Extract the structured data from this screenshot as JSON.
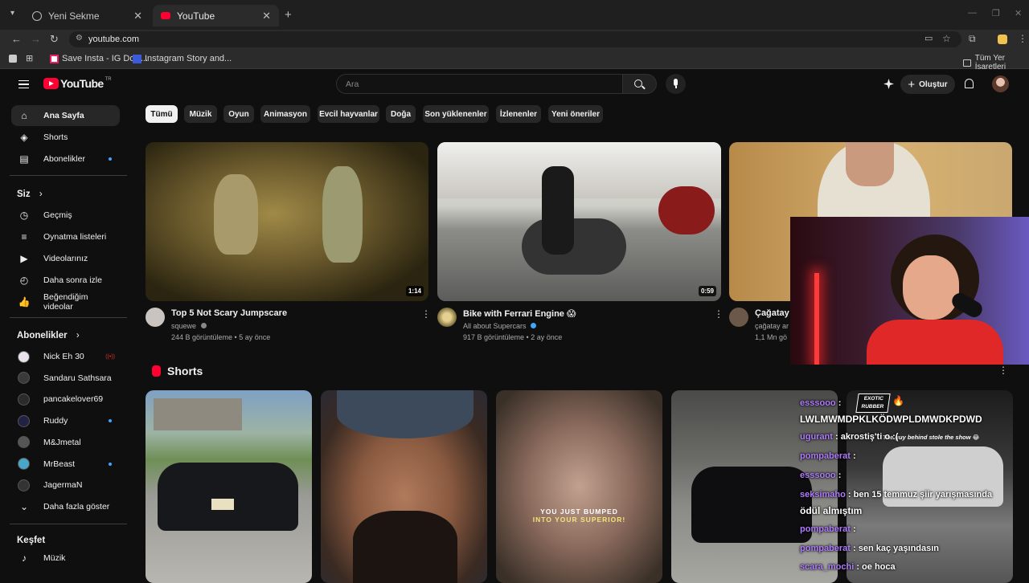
{
  "browser": {
    "tabs": [
      {
        "label": "Yeni Sekme",
        "active": false
      },
      {
        "label": "YouTube",
        "active": true
      }
    ],
    "new_tab_icon": "+",
    "url": "youtube.com",
    "bookmarks": [
      {
        "label": "Save Insta - IG Dow..."
      },
      {
        "label": "Instagram Story and..."
      }
    ],
    "all_bookmarks_label": "Tüm Yer İşaretleri"
  },
  "header": {
    "logo_text": "YouTube",
    "logo_region": "TR",
    "search_placeholder": "Ara",
    "create_label": "Oluştur"
  },
  "sidebar": {
    "main_items": [
      {
        "label": "Ana Sayfa",
        "icon": "home-icon",
        "active": true
      },
      {
        "label": "Shorts",
        "icon": "shorts-icon"
      },
      {
        "label": "Abonelikler",
        "icon": "subscriptions-icon",
        "dot": true
      }
    ],
    "you_heading": "Siz",
    "you_items": [
      {
        "label": "Geçmiş",
        "icon": "history-icon"
      },
      {
        "label": "Oynatma listeleri",
        "icon": "playlists-icon"
      },
      {
        "label": "Videolarınız",
        "icon": "your-videos-icon"
      },
      {
        "label": "Daha sonra izle",
        "icon": "watch-later-icon"
      },
      {
        "label": "Beğendiğim videolar",
        "icon": "liked-videos-icon"
      }
    ],
    "subs_heading": "Abonelikler",
    "subscriptions": [
      {
        "label": "Nick Eh 30",
        "color": "#e9e2ec",
        "live": true
      },
      {
        "label": "Sandaru Sathsara",
        "color": "#3a3a3a"
      },
      {
        "label": "pancakelover69",
        "color": "#2b2b2b"
      },
      {
        "label": "Ruddy",
        "color": "#222244",
        "dot": true
      },
      {
        "label": "M&Jmetal",
        "color": "#555555"
      },
      {
        "label": "MrBeast",
        "color": "#4aa6c9",
        "dot": true
      },
      {
        "label": "JagermaN",
        "color": "#333333"
      }
    ],
    "show_more_label": "Daha fazla göster",
    "explore_heading": "Keşfet",
    "explore_items": [
      {
        "label": "Müzik",
        "icon": "music-icon"
      }
    ]
  },
  "chips": [
    {
      "label": "Tümü",
      "active": true
    },
    {
      "label": "Müzik"
    },
    {
      "label": "Oyun"
    },
    {
      "label": "Animasyon"
    },
    {
      "label": "Evcil hayvanlar"
    },
    {
      "label": "Doğa"
    },
    {
      "label": "Son yüklenenler"
    },
    {
      "label": "İzlenenler"
    },
    {
      "label": "Yeni öneriler"
    }
  ],
  "videos": [
    {
      "title": "Top 5 Not Scary Jumpscare",
      "channel": "squewe",
      "verified": true,
      "meta": "244 B görüntüleme • 5 ay önce",
      "duration": "1:14"
    },
    {
      "title": "Bike with Ferrari Engine 😱",
      "channel": "All about Supercars",
      "verified": true,
      "meta": "917 B görüntüleme • 2 ay önce",
      "duration": "0:59"
    },
    {
      "title": "Çağatay A",
      "channel": "çağatay ar",
      "meta": "1,1 Mn gö",
      "duration": ""
    }
  ],
  "shorts_heading": "Shorts",
  "short_overlay_text": [
    "YOU JUST BUMPED",
    "INTO YOUR SUPERIOR!"
  ],
  "stream_overlay": {
    "badge_line1": "EXOTIC",
    "badge_line2": "RUBBER",
    "chat": [
      {
        "name": "esssooo",
        "text": ""
      },
      {
        "name": "",
        "text": "LWLMWMDPKLKÖDWPLDMWDKPDWD"
      },
      {
        "name": "ugurant",
        "text": "akrostiş'ti o :("
      },
      {
        "name": "pompaberat",
        "text": ""
      },
      {
        "name": "esssooo",
        "text": ""
      },
      {
        "name": "seksimaho",
        "text": "ben 15 temmuz şiir yarışmasında"
      },
      {
        "name": "",
        "text": "ödül almıştım"
      },
      {
        "name": "pompaberat",
        "text": ""
      },
      {
        "name": "pompaberat",
        "text": "sen kaç yaşındasın"
      },
      {
        "name": "scara_mochi",
        "text": "oe hoca"
      }
    ],
    "video_caption": "The guy behind stole the show 😂"
  }
}
